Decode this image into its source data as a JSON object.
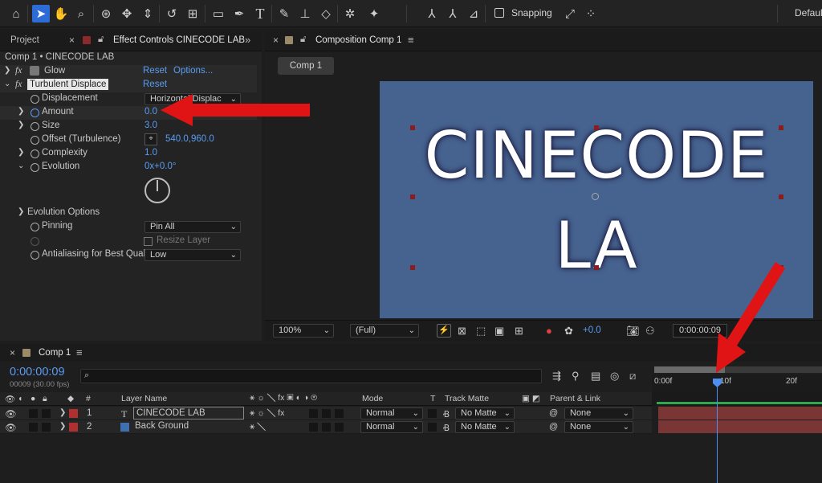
{
  "toolbar": {
    "snapping_label": "Snapping",
    "workspace_label": "Default",
    "icons": [
      "home-icon",
      "selection-arrow-icon",
      "hand-icon",
      "zoom-icon",
      "orbit-camera-icon",
      "pan-camera-icon",
      "dolly-camera-icon",
      "rotate-icon",
      "pan-behind-icon",
      "rectangle-icon",
      "pen-icon",
      "type-icon",
      "brush-icon",
      "clone-stamp-icon",
      "eraser-icon",
      "roto-brush-icon",
      "puppet-pin-icon"
    ]
  },
  "left_panel": {
    "project_tab": "Project",
    "effect_tab": "Effect Controls CINECODE LAB",
    "breadcrumb": "Comp 1 • CINECODE LAB",
    "glow": {
      "name": "Glow",
      "reset": "Reset",
      "options": "Options..."
    },
    "turbulent": {
      "name": "Turbulent Displace",
      "reset": "Reset"
    },
    "props": {
      "displacement_label": "Displacement",
      "displacement_value": "Horizontal Displac",
      "amount_label": "Amount",
      "amount_value": "0.0",
      "size_label": "Size",
      "size_value": "3.0",
      "offset_label": "Offset (Turbulence)",
      "offset_value": "540.0,960.0",
      "complexity_label": "Complexity",
      "complexity_value": "1.0",
      "evolution_label": "Evolution",
      "evolution_value": "0x+0.0°",
      "evolution_options_label": "Evolution Options",
      "pinning_label": "Pinning",
      "pinning_value": "Pin All",
      "resize_label": "Resize Layer",
      "antialias_label": "Antialiasing for Best Quali",
      "antialias_value": "Low"
    }
  },
  "comp_panel": {
    "tab": "Composition Comp 1",
    "comp_button": "Comp 1",
    "line1": "CINECODE",
    "line2": "LA",
    "canvas_color": "#46628f",
    "zoom": "100%",
    "resolution": "(Full)",
    "exposure": "+0.0",
    "timecode": "0:00:00:09"
  },
  "timeline": {
    "tab": "Comp 1",
    "timecode": "0:00:00:09",
    "frames": "00009 (30.00 fps)",
    "search_placeholder": "",
    "ruler": [
      "0:00f",
      "10f",
      "20f"
    ],
    "headers": {
      "hash": "#",
      "layer_name": "Layer Name",
      "mode": "Mode",
      "t": "T",
      "track_matte": "Track Matte",
      "parent_link": "Parent & Link"
    },
    "layers": [
      {
        "num": "1",
        "type": "T",
        "name": "CINECODE LAB",
        "mode": "Normal",
        "matte": "No Matte",
        "parent": "None",
        "label_color": "#b03030"
      },
      {
        "num": "2",
        "type": "",
        "name": "Back Ground",
        "mode": "Normal",
        "matte": "No Matte",
        "parent": "None",
        "label_color": "#b03030"
      }
    ]
  },
  "annotations": {
    "arrow_color": "#e01414"
  }
}
